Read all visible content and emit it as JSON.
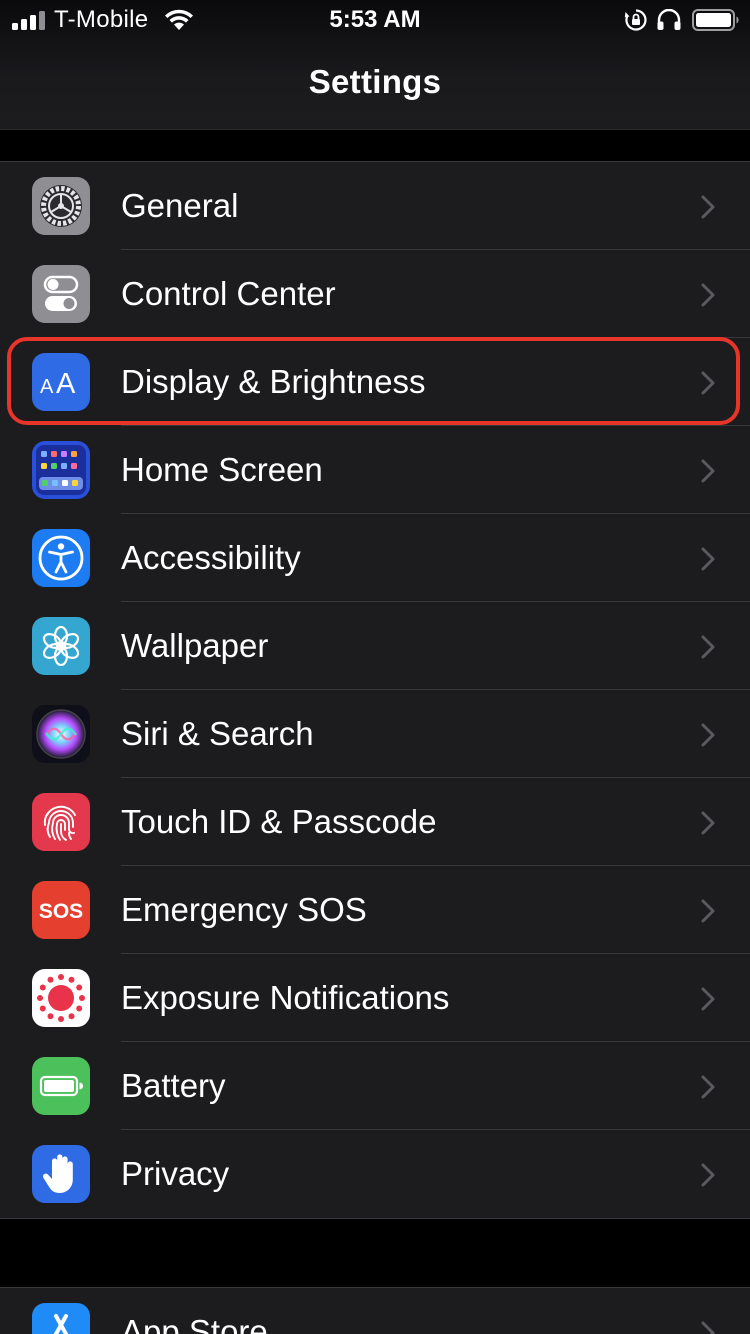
{
  "status_bar": {
    "carrier": "T-Mobile",
    "time": "5:53 AM",
    "icons": [
      "signal-icon",
      "wifi-icon",
      "rotation-lock-icon",
      "headphones-icon",
      "battery-icon"
    ]
  },
  "nav": {
    "title": "Settings"
  },
  "settings": {
    "items": [
      {
        "label": "General",
        "icon": "gear-icon",
        "color": "#8e8e93"
      },
      {
        "label": "Control Center",
        "icon": "toggles-icon",
        "color": "#8e8e93"
      },
      {
        "label": "Display & Brightness",
        "icon": "text-size-icon",
        "color": "#2f6be5",
        "highlighted": true
      },
      {
        "label": "Home Screen",
        "icon": "app-grid-icon",
        "color": "#2a4fd8"
      },
      {
        "label": "Accessibility",
        "icon": "accessibility-icon",
        "color": "#1e7cf2"
      },
      {
        "label": "Wallpaper",
        "icon": "flower-icon",
        "color": "#34a6cf"
      },
      {
        "label": "Siri & Search",
        "icon": "siri-icon",
        "color": "#1a1a2e"
      },
      {
        "label": "Touch ID & Passcode",
        "icon": "fingerprint-icon",
        "color": "#e4384c"
      },
      {
        "label": "Emergency SOS",
        "icon": "sos-icon",
        "color": "#e5402f",
        "icon_text": "SOS"
      },
      {
        "label": "Exposure Notifications",
        "icon": "exposure-icon",
        "color": "#ffffff"
      },
      {
        "label": "Battery",
        "icon": "battery-app-icon",
        "color": "#4cc05a"
      },
      {
        "label": "Privacy",
        "icon": "hand-icon",
        "color": "#2f6be5"
      }
    ],
    "second_group": [
      {
        "label": "App Store",
        "icon": "app-store-icon",
        "color": "#1e8bf7"
      }
    ]
  },
  "theme": {
    "background": "#000000",
    "group_background": "#1c1c1e",
    "separator": "#38383a",
    "chevron": "#5a5a5e",
    "highlight_outline": "#e8352a"
  }
}
